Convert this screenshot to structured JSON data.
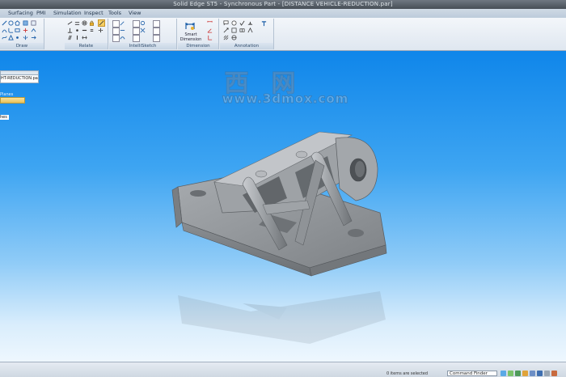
{
  "window": {
    "title": "Solid Edge ST5 - Synchronous Part - [DISTANCE VEHICLE-REDUCTION.par]"
  },
  "menu": {
    "tabs": [
      "Surfacing",
      "PMI",
      "Simulation",
      "Inspect",
      "Tools",
      "View"
    ]
  },
  "ribbon": {
    "groups": [
      {
        "label": "Draw"
      },
      {
        "label": "Relate"
      },
      {
        "label": "IntelliSketch"
      },
      {
        "label": "Dimension"
      },
      {
        "label": "Annotation"
      }
    ],
    "smart_dimension": {
      "line1": "Smart",
      "line2": "Dimension"
    }
  },
  "pathfinder": {
    "file_name": "HT-REDUCTION.par",
    "planes_label": "Planes",
    "sketches_label": "hes"
  },
  "watermark": {
    "cn": "西网",
    "url": "www.3dmox.com"
  },
  "status": {
    "message": "0 items are selected",
    "command_finder_placeholder": "Command Finder"
  },
  "colors": {
    "viewport_top": "#0f86ea",
    "viewport_bottom": "#eef7fe",
    "part": "#8e9296"
  }
}
